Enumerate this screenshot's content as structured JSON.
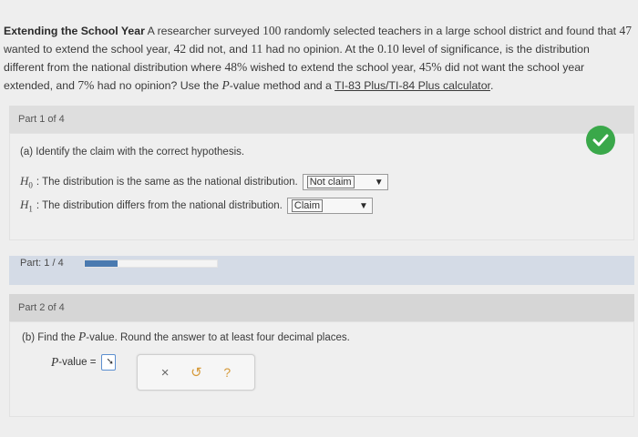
{
  "problem": {
    "title": "Extending the School Year",
    "seg1": " A researcher surveyed ",
    "n": "100",
    "seg2": " randomly selected teachers in a large school district and found that ",
    "yes": "47",
    "seg3": " wanted to extend the school year, ",
    "no": "42",
    "seg4": " did not, and ",
    "noop": "11",
    "seg5": " had no opinion. At the ",
    "alpha": "0.10",
    "seg6": " level of significance, is the distribution different from the national distribution where ",
    "p1": "48%",
    "seg7": " wished to extend the school year, ",
    "p2": "45%",
    "seg8": " did not want the school year extended, and ",
    "p3": "7%",
    "seg9": " had no opinion? Use the ",
    "pvar": "P",
    "seg10": "-value method and a ",
    "calc": "TI-83 Plus/TI-84 Plus calculator",
    "seg11": "."
  },
  "part1": {
    "header": "Part 1 of 4",
    "question": "(a) Identify the claim with the correct hypothesis.",
    "h0": {
      "symbol": "H",
      "sub": "0",
      "text": ": The distribution is the same as the national distribution.",
      "selected": "Not claim"
    },
    "h1": {
      "symbol": "H",
      "sub": "1",
      "text": ": The distribution differs from the national distribution.",
      "selected": "Claim"
    }
  },
  "progress": {
    "label": "Part: 1 / 4",
    "fraction": 0.25
  },
  "part2": {
    "header": "Part 2 of 4",
    "question_pre": "(b) Find the ",
    "question_var": "P",
    "question_post": "-value. Round the answer to at least four decimal places.",
    "pvalue_label": "P",
    "pvalue_suffix": "-value =",
    "answer_value": ""
  },
  "tools": {
    "clear": "×",
    "undo": "↺",
    "help": "?"
  },
  "colors": {
    "check": "#3aa84a",
    "progress_fill": "#4a7ab0",
    "answer_border": "#5b8fd0"
  }
}
